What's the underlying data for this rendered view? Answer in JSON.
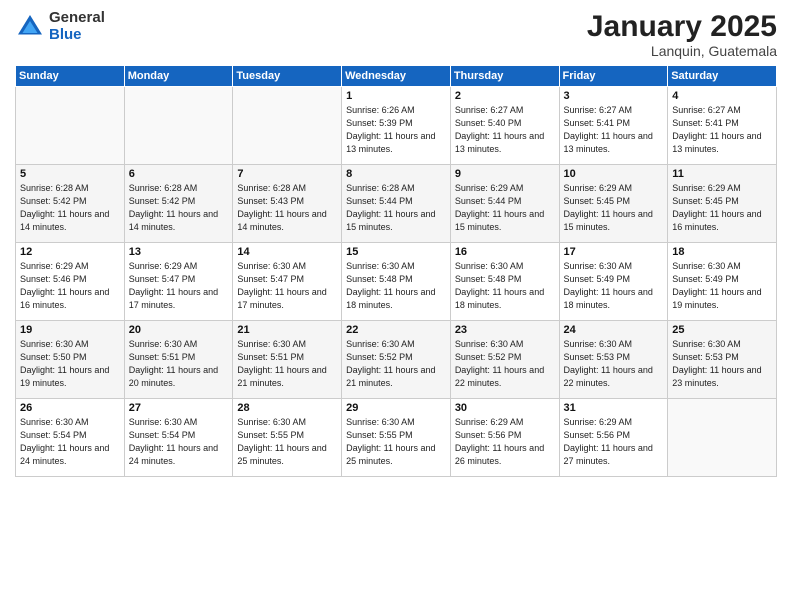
{
  "logo": {
    "general": "General",
    "blue": "Blue"
  },
  "title": "January 2025",
  "subtitle": "Lanquin, Guatemala",
  "weekdays": [
    "Sunday",
    "Monday",
    "Tuesday",
    "Wednesday",
    "Thursday",
    "Friday",
    "Saturday"
  ],
  "weeks": [
    [
      {
        "day": "",
        "sunrise": "",
        "sunset": "",
        "daylight": ""
      },
      {
        "day": "",
        "sunrise": "",
        "sunset": "",
        "daylight": ""
      },
      {
        "day": "",
        "sunrise": "",
        "sunset": "",
        "daylight": ""
      },
      {
        "day": "1",
        "sunrise": "Sunrise: 6:26 AM",
        "sunset": "Sunset: 5:39 PM",
        "daylight": "Daylight: 11 hours and 13 minutes."
      },
      {
        "day": "2",
        "sunrise": "Sunrise: 6:27 AM",
        "sunset": "Sunset: 5:40 PM",
        "daylight": "Daylight: 11 hours and 13 minutes."
      },
      {
        "day": "3",
        "sunrise": "Sunrise: 6:27 AM",
        "sunset": "Sunset: 5:41 PM",
        "daylight": "Daylight: 11 hours and 13 minutes."
      },
      {
        "day": "4",
        "sunrise": "Sunrise: 6:27 AM",
        "sunset": "Sunset: 5:41 PM",
        "daylight": "Daylight: 11 hours and 13 minutes."
      }
    ],
    [
      {
        "day": "5",
        "sunrise": "Sunrise: 6:28 AM",
        "sunset": "Sunset: 5:42 PM",
        "daylight": "Daylight: 11 hours and 14 minutes."
      },
      {
        "day": "6",
        "sunrise": "Sunrise: 6:28 AM",
        "sunset": "Sunset: 5:42 PM",
        "daylight": "Daylight: 11 hours and 14 minutes."
      },
      {
        "day": "7",
        "sunrise": "Sunrise: 6:28 AM",
        "sunset": "Sunset: 5:43 PM",
        "daylight": "Daylight: 11 hours and 14 minutes."
      },
      {
        "day": "8",
        "sunrise": "Sunrise: 6:28 AM",
        "sunset": "Sunset: 5:44 PM",
        "daylight": "Daylight: 11 hours and 15 minutes."
      },
      {
        "day": "9",
        "sunrise": "Sunrise: 6:29 AM",
        "sunset": "Sunset: 5:44 PM",
        "daylight": "Daylight: 11 hours and 15 minutes."
      },
      {
        "day": "10",
        "sunrise": "Sunrise: 6:29 AM",
        "sunset": "Sunset: 5:45 PM",
        "daylight": "Daylight: 11 hours and 15 minutes."
      },
      {
        "day": "11",
        "sunrise": "Sunrise: 6:29 AM",
        "sunset": "Sunset: 5:45 PM",
        "daylight": "Daylight: 11 hours and 16 minutes."
      }
    ],
    [
      {
        "day": "12",
        "sunrise": "Sunrise: 6:29 AM",
        "sunset": "Sunset: 5:46 PM",
        "daylight": "Daylight: 11 hours and 16 minutes."
      },
      {
        "day": "13",
        "sunrise": "Sunrise: 6:29 AM",
        "sunset": "Sunset: 5:47 PM",
        "daylight": "Daylight: 11 hours and 17 minutes."
      },
      {
        "day": "14",
        "sunrise": "Sunrise: 6:30 AM",
        "sunset": "Sunset: 5:47 PM",
        "daylight": "Daylight: 11 hours and 17 minutes."
      },
      {
        "day": "15",
        "sunrise": "Sunrise: 6:30 AM",
        "sunset": "Sunset: 5:48 PM",
        "daylight": "Daylight: 11 hours and 18 minutes."
      },
      {
        "day": "16",
        "sunrise": "Sunrise: 6:30 AM",
        "sunset": "Sunset: 5:48 PM",
        "daylight": "Daylight: 11 hours and 18 minutes."
      },
      {
        "day": "17",
        "sunrise": "Sunrise: 6:30 AM",
        "sunset": "Sunset: 5:49 PM",
        "daylight": "Daylight: 11 hours and 18 minutes."
      },
      {
        "day": "18",
        "sunrise": "Sunrise: 6:30 AM",
        "sunset": "Sunset: 5:49 PM",
        "daylight": "Daylight: 11 hours and 19 minutes."
      }
    ],
    [
      {
        "day": "19",
        "sunrise": "Sunrise: 6:30 AM",
        "sunset": "Sunset: 5:50 PM",
        "daylight": "Daylight: 11 hours and 19 minutes."
      },
      {
        "day": "20",
        "sunrise": "Sunrise: 6:30 AM",
        "sunset": "Sunset: 5:51 PM",
        "daylight": "Daylight: 11 hours and 20 minutes."
      },
      {
        "day": "21",
        "sunrise": "Sunrise: 6:30 AM",
        "sunset": "Sunset: 5:51 PM",
        "daylight": "Daylight: 11 hours and 21 minutes."
      },
      {
        "day": "22",
        "sunrise": "Sunrise: 6:30 AM",
        "sunset": "Sunset: 5:52 PM",
        "daylight": "Daylight: 11 hours and 21 minutes."
      },
      {
        "day": "23",
        "sunrise": "Sunrise: 6:30 AM",
        "sunset": "Sunset: 5:52 PM",
        "daylight": "Daylight: 11 hours and 22 minutes."
      },
      {
        "day": "24",
        "sunrise": "Sunrise: 6:30 AM",
        "sunset": "Sunset: 5:53 PM",
        "daylight": "Daylight: 11 hours and 22 minutes."
      },
      {
        "day": "25",
        "sunrise": "Sunrise: 6:30 AM",
        "sunset": "Sunset: 5:53 PM",
        "daylight": "Daylight: 11 hours and 23 minutes."
      }
    ],
    [
      {
        "day": "26",
        "sunrise": "Sunrise: 6:30 AM",
        "sunset": "Sunset: 5:54 PM",
        "daylight": "Daylight: 11 hours and 24 minutes."
      },
      {
        "day": "27",
        "sunrise": "Sunrise: 6:30 AM",
        "sunset": "Sunset: 5:54 PM",
        "daylight": "Daylight: 11 hours and 24 minutes."
      },
      {
        "day": "28",
        "sunrise": "Sunrise: 6:30 AM",
        "sunset": "Sunset: 5:55 PM",
        "daylight": "Daylight: 11 hours and 25 minutes."
      },
      {
        "day": "29",
        "sunrise": "Sunrise: 6:30 AM",
        "sunset": "Sunset: 5:55 PM",
        "daylight": "Daylight: 11 hours and 25 minutes."
      },
      {
        "day": "30",
        "sunrise": "Sunrise: 6:29 AM",
        "sunset": "Sunset: 5:56 PM",
        "daylight": "Daylight: 11 hours and 26 minutes."
      },
      {
        "day": "31",
        "sunrise": "Sunrise: 6:29 AM",
        "sunset": "Sunset: 5:56 PM",
        "daylight": "Daylight: 11 hours and 27 minutes."
      },
      {
        "day": "",
        "sunrise": "",
        "sunset": "",
        "daylight": ""
      }
    ]
  ]
}
